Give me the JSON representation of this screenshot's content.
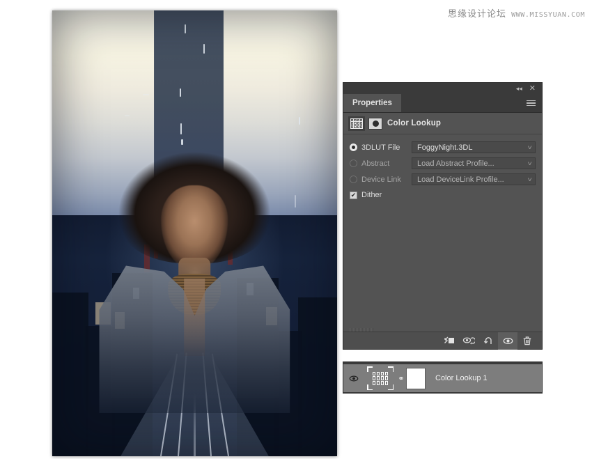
{
  "watermark": {
    "chinese": "思缘设计论坛",
    "url": "WWW.MISSYUAN.COM"
  },
  "artwork": {
    "name": "double-exposure-portrait-city-night",
    "description": "Double exposure of a woman's portrait blended with a rainy night street scene with tram tracks"
  },
  "properties_panel": {
    "titlebar": {
      "collapse_label": "«",
      "close_label": "✕"
    },
    "tab_label": "Properties",
    "menu_label": "panel-menu",
    "header_title": "Color Lookup",
    "rows": [
      {
        "id": "lut3d",
        "label": "3DLUT File",
        "selected": true,
        "value": "FoggyNight.3DL",
        "enabled": true
      },
      {
        "id": "abstract",
        "label": "Abstract",
        "selected": false,
        "value": "Load Abstract Profile...",
        "enabled": false
      },
      {
        "id": "devicelink",
        "label": "Device Link",
        "selected": false,
        "value": "Load DeviceLink Profile...",
        "enabled": false
      }
    ],
    "dither": {
      "label": "Dither",
      "checked": true,
      "check_glyph": "✔"
    },
    "footer_buttons": [
      {
        "id": "clip-to-layer",
        "label": "clip-to-layer-icon"
      },
      {
        "id": "view-previous-state",
        "label": "view-previous-state-icon"
      },
      {
        "id": "reset",
        "label": "reset-icon"
      },
      {
        "id": "toggle-visibility",
        "label": "visibility-icon",
        "active": true
      },
      {
        "id": "delete",
        "label": "delete-icon"
      }
    ]
  },
  "layers_panel": {
    "layer": {
      "name": "Color Lookup 1",
      "visible": true,
      "linked": true,
      "link_glyph": "⚭",
      "thumbnail": "color-lookup-grid",
      "mask": "white-layer-mask"
    }
  },
  "colors": {
    "panel_bg": "#535353",
    "panel_header_bg": "#3a3a3a",
    "field_bg": "#4a4a4a",
    "footer_bg": "#4e4e4e",
    "layer_row_bg": "#7d7d7d",
    "text": "#d6d6d6"
  }
}
